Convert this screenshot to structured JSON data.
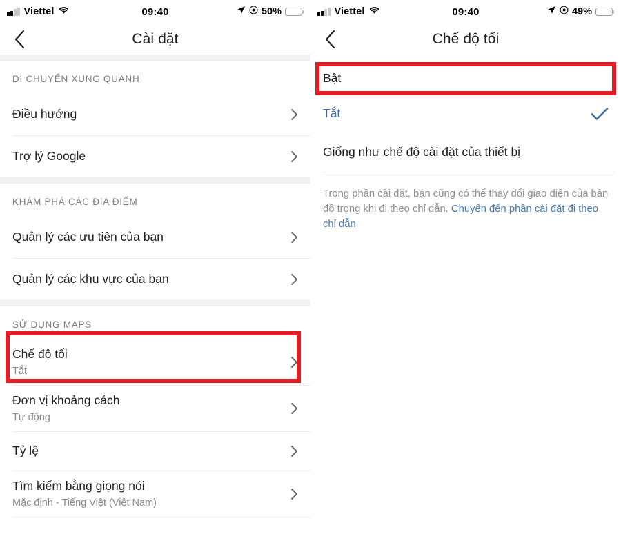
{
  "left": {
    "statusbar": {
      "carrier": "Viettel",
      "time": "09:40",
      "battery_pct": "50%",
      "signal_icon": "signal-bars-icon",
      "wifi_icon": "wifi-icon",
      "location_icon": "location-arrow-icon",
      "alarm_icon": "alarm-icon",
      "battery_icon": "battery-icon",
      "battery_color": "#f5c542"
    },
    "nav": {
      "back_icon": "chevron-left-icon",
      "title": "Cài đặt"
    },
    "sections": [
      {
        "header": "DI CHUYỂN XUNG QUANH",
        "rows": [
          {
            "title": "Điều hướng",
            "sub": "",
            "chevron": "chevron-right-icon"
          },
          {
            "title": "Trợ lý Google",
            "sub": "",
            "chevron": "chevron-right-icon"
          }
        ]
      },
      {
        "header": "KHÁM PHÁ CÁC ĐỊA ĐIỂM",
        "rows": [
          {
            "title": "Quản lý các ưu tiên của bạn",
            "sub": "",
            "chevron": "chevron-right-icon"
          },
          {
            "title": "Quản lý các khu vực của bạn",
            "sub": "",
            "chevron": "chevron-right-icon"
          }
        ]
      },
      {
        "header": "SỬ DỤNG MAPS",
        "rows": [
          {
            "title": "Chế độ tối",
            "sub": "Tắt",
            "chevron": "chevron-right-icon"
          },
          {
            "title": "Đơn vị khoảng cách",
            "sub": "Tự động",
            "chevron": "chevron-right-icon"
          },
          {
            "title": "Tỷ lệ",
            "sub": "",
            "chevron": "chevron-right-icon"
          },
          {
            "title": "Tìm kiếm bằng giọng nói",
            "sub": "Mặc định - Tiếng Việt (Việt Nam)",
            "chevron": "chevron-right-icon"
          }
        ]
      }
    ],
    "highlight_color": "#e41e26"
  },
  "right": {
    "statusbar": {
      "carrier": "Viettel",
      "time": "09:40",
      "battery_pct": "49%",
      "signal_icon": "signal-bars-icon",
      "wifi_icon": "wifi-icon",
      "location_icon": "location-arrow-icon",
      "alarm_icon": "alarm-icon",
      "battery_icon": "battery-icon",
      "battery_color": "#f5c542"
    },
    "nav": {
      "back_icon": "chevron-left-icon",
      "title": "Chế độ tối"
    },
    "options": [
      {
        "label": "Bật",
        "selected": false,
        "highlighted": true
      },
      {
        "label": "Tắt",
        "selected": true,
        "highlighted": false
      },
      {
        "label": "Giống như chế độ cài đặt của thiết bị",
        "selected": false,
        "highlighted": false
      }
    ],
    "selected_color": "#3c6ca6",
    "check_icon": "checkmark-icon",
    "note": {
      "text": "Trong phần cài đặt, bạn cũng có thể thay đổi giao diện của bản đồ trong khi đi theo chỉ dẫn. ",
      "link": "Chuyển đến phần cài đặt đi theo chỉ dẫn"
    },
    "highlight_color": "#e41e26"
  }
}
